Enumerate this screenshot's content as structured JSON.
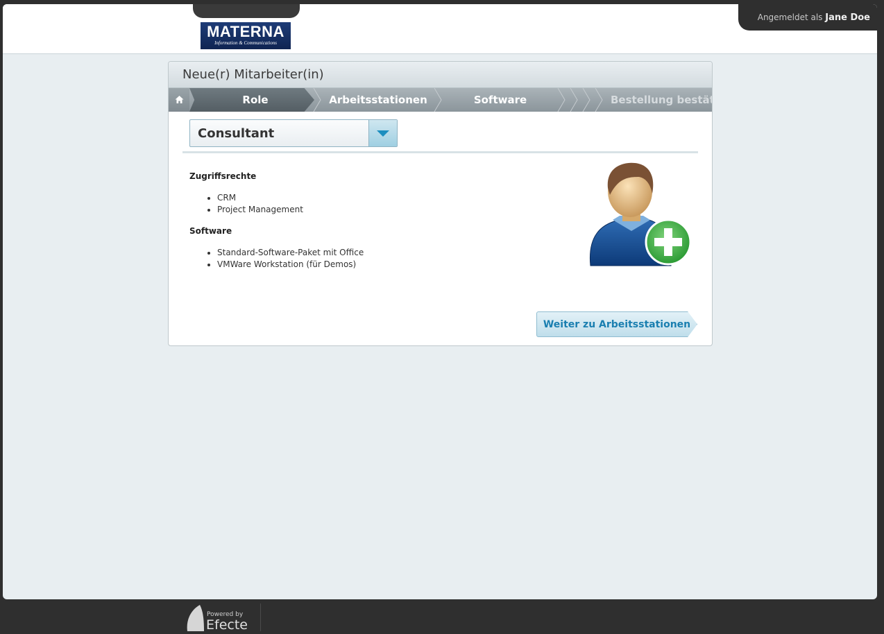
{
  "header": {
    "logo_main": "MATERNA",
    "logo_sub": "Information & Communications",
    "logged_in_prefix": "Angemeldet als",
    "user_name": "Jane Doe"
  },
  "panel": {
    "title": "Neue(r) Mitarbeiter(in)",
    "steps": [
      "Role",
      "Arbeitsstationen",
      "Software",
      "Bestellung bestätige"
    ],
    "role_select": {
      "value": "Consultant"
    },
    "access_heading": "Zugriffsrechte",
    "access_items": [
      "CRM",
      "Project Management"
    ],
    "software_heading": "Software",
    "software_items": [
      "Standard-Software-Paket mit Office",
      "VMWare Workstation (für Demos)"
    ],
    "next_button": "Weiter zu Arbeitsstationen"
  },
  "footer": {
    "powered_by": "Powered by",
    "brand": "Efecte"
  },
  "colors": {
    "accent": "#1c8ebf",
    "button_text": "#1a7fb0",
    "active_step": "#5e686e"
  }
}
